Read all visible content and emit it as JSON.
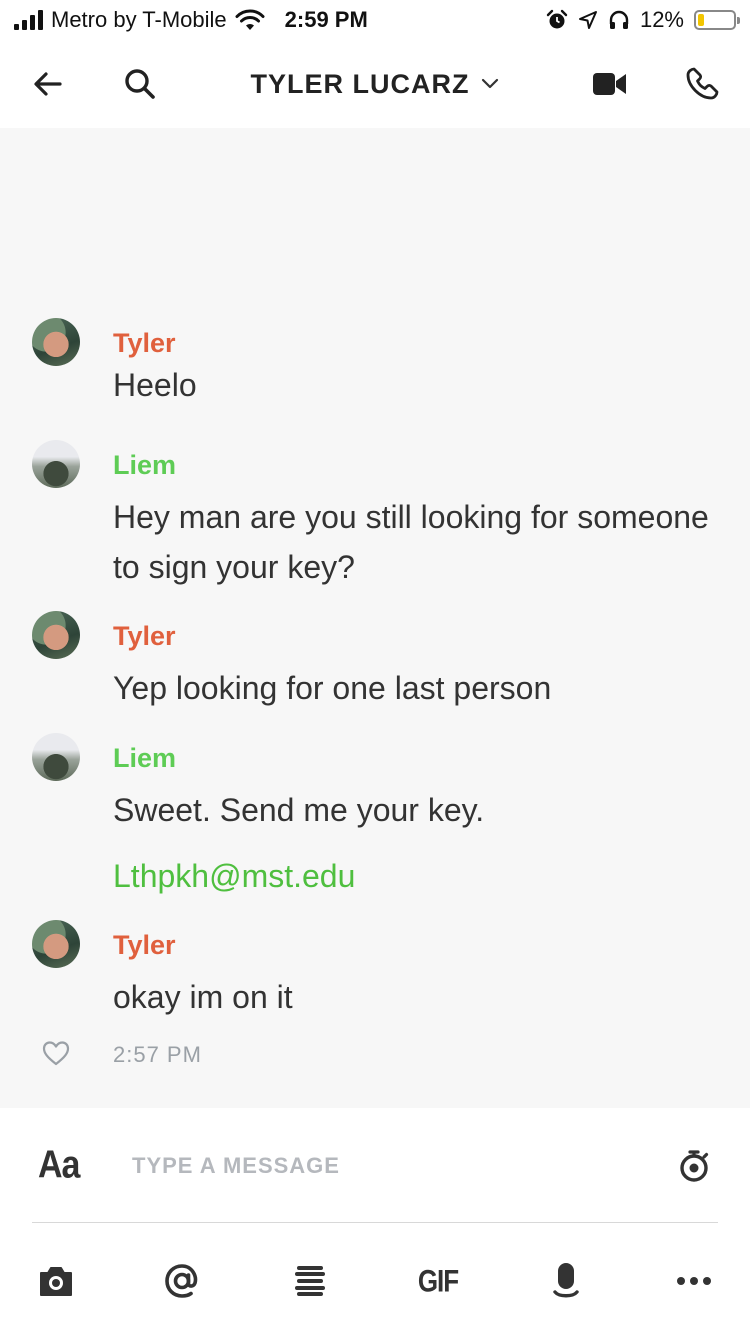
{
  "status_bar": {
    "carrier": "Metro by T-Mobile",
    "time": "2:59 PM",
    "battery_percent": "12%",
    "battery_level": 0.12,
    "battery_color": "#f2c500"
  },
  "header": {
    "title": "TYLER LUCARZ",
    "icons": [
      "back-arrow-icon",
      "search-icon",
      "chevron-down-icon",
      "video-camera-icon",
      "phone-icon"
    ]
  },
  "messages": [
    {
      "sender": "Tyler",
      "text": "Heelo"
    },
    {
      "sender": "Liem",
      "text": "Hey man are you still looking for someone to sign your key?"
    },
    {
      "sender": "Tyler",
      "text": "Yep looking for one last person"
    },
    {
      "sender": "Liem",
      "text": "Sweet. Send me your key.",
      "link": "Lthpkh@mst.edu"
    },
    {
      "sender": "Tyler",
      "text": "okay im on it"
    }
  ],
  "last_message_time": "2:57 PM",
  "colors": {
    "tyler": "#e0603d",
    "liem": "#5ecc55",
    "link": "#4fbf3f"
  },
  "composer": {
    "format_label": "Aa",
    "placeholder": "TYPE A MESSAGE",
    "gif_label": "GIF",
    "icons": [
      "camera-icon",
      "at-mention-icon",
      "bitmoji-icon",
      "gif-icon",
      "microphone-icon",
      "more-icon",
      "timer-icon"
    ]
  }
}
